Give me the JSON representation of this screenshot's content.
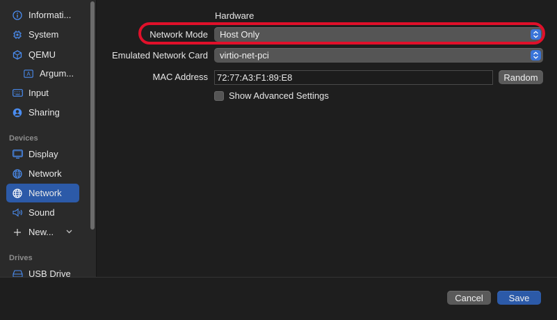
{
  "sidebar": {
    "items": [
      {
        "label": "Informati...",
        "icon": "info-icon"
      },
      {
        "label": "System",
        "icon": "cpu-icon"
      },
      {
        "label": "QEMU",
        "icon": "cube-icon"
      },
      {
        "label": "Argum...",
        "icon": "text-box-icon"
      },
      {
        "label": "Input",
        "icon": "keyboard-icon"
      },
      {
        "label": "Sharing",
        "icon": "person-circle-icon"
      }
    ],
    "devices_section": "Devices",
    "devices": [
      {
        "label": "Display",
        "icon": "display-icon"
      },
      {
        "label": "Network",
        "icon": "globe-icon"
      },
      {
        "label": "Network",
        "icon": "globe-icon",
        "selected": true
      },
      {
        "label": "Sound",
        "icon": "speaker-icon"
      },
      {
        "label": "New...",
        "icon": "plus-icon"
      }
    ],
    "drives_section": "Drives",
    "drives": [
      {
        "label": "USB Drive",
        "icon": "drive-icon"
      }
    ]
  },
  "main": {
    "section_title": "Hardware",
    "network_mode": {
      "label": "Network Mode",
      "value": "Host Only"
    },
    "network_card": {
      "label": "Emulated Network Card",
      "value": "virtio-net-pci"
    },
    "mac_address": {
      "label": "MAC Address",
      "value": "72:77:A3:F1:89:E8",
      "random_label": "Random"
    },
    "advanced": {
      "label": "Show Advanced Settings",
      "checked": false
    }
  },
  "footer": {
    "cancel_label": "Cancel",
    "save_label": "Save"
  },
  "colors": {
    "accent": "#2c5aa8",
    "highlight": "#e0102a",
    "stepper": "#3a74d8"
  }
}
